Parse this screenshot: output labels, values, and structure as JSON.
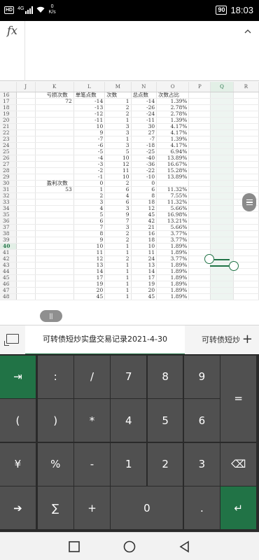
{
  "status_bar": {
    "hd": "HD",
    "network": "4G",
    "speed_value": "0",
    "speed_unit": "K/s",
    "battery": "90",
    "time": "18:03"
  },
  "formula_bar": {
    "fx_label": "fx",
    "value": "",
    "collapse_icon": "chevron-up-icon"
  },
  "grid": {
    "columns": [
      "J",
      "K",
      "L",
      "M",
      "N",
      "O",
      "P",
      "Q",
      "R"
    ],
    "selected_column": "Q",
    "selected_row": "40",
    "rows": [
      {
        "n": "16",
        "k": "亏损次数",
        "l": "单笔点数",
        "m": "次数",
        "n2": "",
        "nn": "总点数",
        "o": "次数占比"
      },
      {
        "n": "17",
        "k": "72",
        "l": "-14",
        "m": "1",
        "nn": "-14",
        "o": "1.39%"
      },
      {
        "n": "18",
        "k": "",
        "l": "-13",
        "m": "2",
        "nn": "-26",
        "o": "2.78%"
      },
      {
        "n": "19",
        "k": "",
        "l": "-12",
        "m": "2",
        "nn": "-24",
        "o": "2.78%"
      },
      {
        "n": "20",
        "k": "",
        "l": "-11",
        "m": "1",
        "nn": "-11",
        "o": "1.39%"
      },
      {
        "n": "21",
        "k": "",
        "l": "10",
        "m": "3",
        "nn": "30",
        "o": "4.17%"
      },
      {
        "n": "22",
        "k": "",
        "l": "9",
        "m": "3",
        "nn": "27",
        "o": "4.17%"
      },
      {
        "n": "23",
        "k": "",
        "l": "-7",
        "m": "1",
        "nn": "-7",
        "o": "1.39%"
      },
      {
        "n": "24",
        "k": "",
        "l": "-6",
        "m": "3",
        "nn": "-18",
        "o": "4.17%"
      },
      {
        "n": "25",
        "k": "",
        "l": "-5",
        "m": "5",
        "nn": "-25",
        "o": "6.94%"
      },
      {
        "n": "26",
        "k": "",
        "l": "-4",
        "m": "10",
        "nn": "-40",
        "o": "13.89%"
      },
      {
        "n": "27",
        "k": "",
        "l": "-3",
        "m": "12",
        "nn": "-36",
        "o": "16.67%"
      },
      {
        "n": "28",
        "k": "",
        "l": "-2",
        "m": "11",
        "nn": "-22",
        "o": "15.28%"
      },
      {
        "n": "29",
        "k": "",
        "l": "-1",
        "m": "10",
        "nn": "-10",
        "o": "13.89%"
      },
      {
        "n": "30",
        "k": "盈利次数",
        "l": "0",
        "m": "2",
        "nn": "0",
        "o": ""
      },
      {
        "n": "31",
        "k": "53",
        "l": "1",
        "m": "6",
        "nn": "6",
        "o": "11.32%"
      },
      {
        "n": "32",
        "k": "",
        "l": "2",
        "m": "4",
        "nn": "8",
        "o": "7.55%"
      },
      {
        "n": "33",
        "k": "",
        "l": "3",
        "m": "6",
        "nn": "18",
        "o": "11.32%"
      },
      {
        "n": "34",
        "k": "",
        "l": "4",
        "m": "3",
        "nn": "12",
        "o": "5.66%"
      },
      {
        "n": "35",
        "k": "",
        "l": "5",
        "m": "9",
        "nn": "45",
        "o": "16.98%"
      },
      {
        "n": "36",
        "k": "",
        "l": "6",
        "m": "7",
        "nn": "42",
        "o": "13.21%"
      },
      {
        "n": "37",
        "k": "",
        "l": "7",
        "m": "3",
        "nn": "21",
        "o": "5.66%"
      },
      {
        "n": "38",
        "k": "",
        "l": "8",
        "m": "2",
        "nn": "16",
        "o": "3.77%"
      },
      {
        "n": "39",
        "k": "",
        "l": "9",
        "m": "2",
        "nn": "18",
        "o": "3.77%"
      },
      {
        "n": "40",
        "k": "",
        "l": "10",
        "m": "1",
        "nn": "10",
        "o": "1.89%"
      },
      {
        "n": "41",
        "k": "",
        "l": "11",
        "m": "1",
        "nn": "11",
        "o": "1.89%"
      },
      {
        "n": "42",
        "k": "",
        "l": "12",
        "m": "2",
        "nn": "24",
        "o": "3.77%"
      },
      {
        "n": "43",
        "k": "",
        "l": "13",
        "m": "1",
        "nn": "13",
        "o": "1.89%"
      },
      {
        "n": "44",
        "k": "",
        "l": "14",
        "m": "1",
        "nn": "14",
        "o": "1.89%"
      },
      {
        "n": "45",
        "k": "",
        "l": "17",
        "m": "1",
        "nn": "17",
        "o": "1.89%"
      },
      {
        "n": "46",
        "k": "",
        "l": "19",
        "m": "1",
        "nn": "19",
        "o": "1.89%"
      },
      {
        "n": "47",
        "k": "",
        "l": "20",
        "m": "1",
        "nn": "20",
        "o": "1.89%"
      },
      {
        "n": "48",
        "k": "",
        "l": "45",
        "m": "1",
        "nn": "45",
        "o": "1.89%"
      }
    ]
  },
  "pause_label": "||",
  "tabs": {
    "sheet_list_icon": "sheet-list-icon",
    "active": "可转债短炒实盘交易记录2021-4-30",
    "next": "可转债短炒",
    "add_label": "+"
  },
  "keyboard": {
    "keys": [
      {
        "id": "tab",
        "label": "⇥",
        "green": true
      },
      {
        "id": "colon",
        "label": ":"
      },
      {
        "id": "slash",
        "label": "/"
      },
      {
        "id": "7",
        "label": "7"
      },
      {
        "id": "8",
        "label": "8"
      },
      {
        "id": "9",
        "label": "9"
      },
      {
        "id": "equals",
        "label": "="
      },
      {
        "id": "lparen",
        "label": "("
      },
      {
        "id": "rparen",
        "label": ")"
      },
      {
        "id": "asterisk",
        "label": "*"
      },
      {
        "id": "4",
        "label": "4"
      },
      {
        "id": "5",
        "label": "5"
      },
      {
        "id": "6",
        "label": "6"
      },
      {
        "id": "yen",
        "label": "¥"
      },
      {
        "id": "percent",
        "label": "%"
      },
      {
        "id": "minus",
        "label": "-"
      },
      {
        "id": "1",
        "label": "1"
      },
      {
        "id": "2",
        "label": "2"
      },
      {
        "id": "3",
        "label": "3"
      },
      {
        "id": "backspace",
        "label": "⌫"
      },
      {
        "id": "go",
        "label": "➔"
      },
      {
        "id": "sum",
        "label": "∑"
      },
      {
        "id": "plus",
        "label": "+"
      },
      {
        "id": "0",
        "label": "0"
      },
      {
        "id": "dot",
        "label": "."
      },
      {
        "id": "enter",
        "label": "↵",
        "green": true
      }
    ]
  },
  "navbar": {
    "recents_icon": "square-icon",
    "home_icon": "circle-icon",
    "back_icon": "triangle-back-icon"
  },
  "colors": {
    "accent": "#217346",
    "key_bg": "#505050",
    "keyboard_bg": "#2a2a2a"
  }
}
